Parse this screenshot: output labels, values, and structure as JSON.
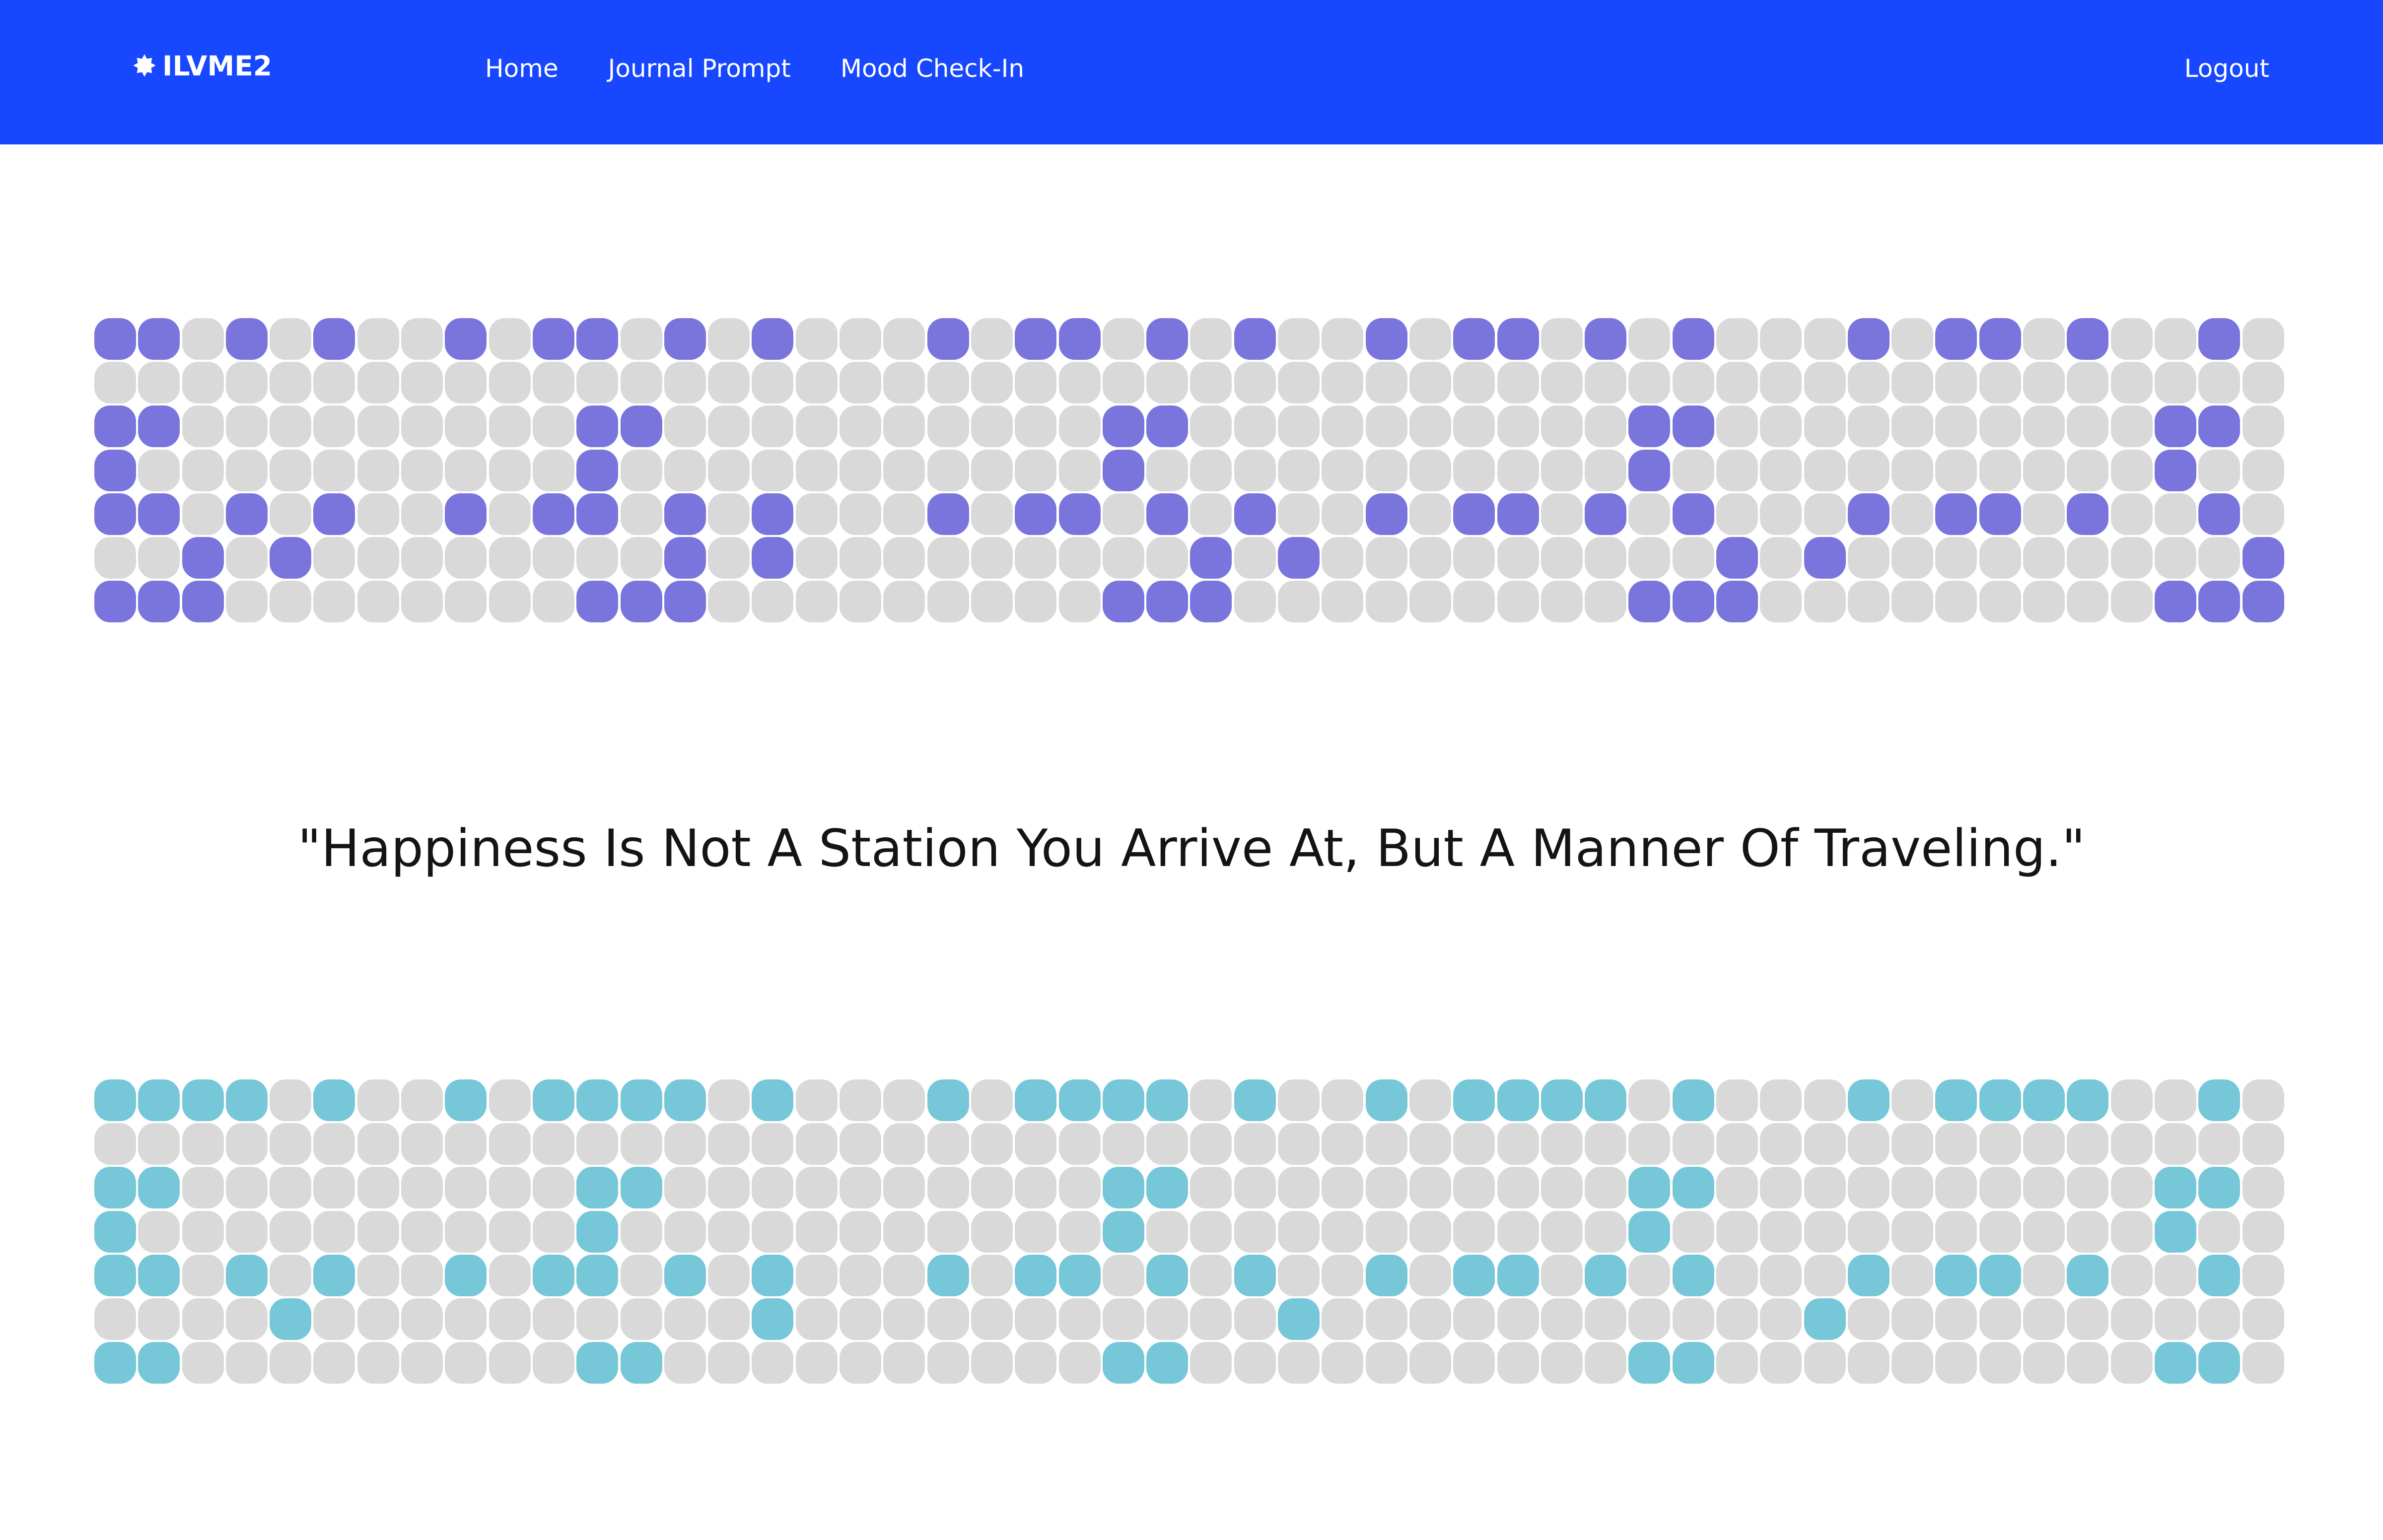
{
  "nav": {
    "brand": "ILVME2",
    "brand_icon": "badge-star-icon",
    "links": [
      "Home",
      "Journal Prompt",
      "Mood Check-In"
    ],
    "logout": "Logout",
    "background_color": "#1747fe",
    "text_color": "#ffffff"
  },
  "quote": "\"Happiness Is Not A Station You Arrive At, But A Manner Of Traveling.\"",
  "top_grid": {
    "active_color": "#7975dc",
    "inactive_color": "#d9d9d9",
    "rows": [
      "11010100101101010001011010100101101010001011010010",
      "00000000000000000000000000000000000000000000000000",
      "11000000000110000000000110000000000110000000000110",
      "10000000000100000000000100000000000100000000000100",
      "11010100101101010001011010100101101010001011010010",
      "00101000000001010000000001010000000001010000000001",
      "11100000000111000000000111000000000111000000000111"
    ]
  },
  "bottom_grid": {
    "active_color": "#76c7d8",
    "inactive_color": "#d9d9d9",
    "rows": [
      "11110100101111010001011110100101111010001011110010",
      "00000000000000000000000000000000000000000000000000",
      "11000000000110000000000110000000000110000000000110",
      "10000000000100000000000100000000000100000000000100",
      "11010100101101010001011010100101101010001011010010",
      "00001000000000010000000000010000000000010000000000",
      "11000000000110000000000110000000000110000000000110"
    ]
  }
}
